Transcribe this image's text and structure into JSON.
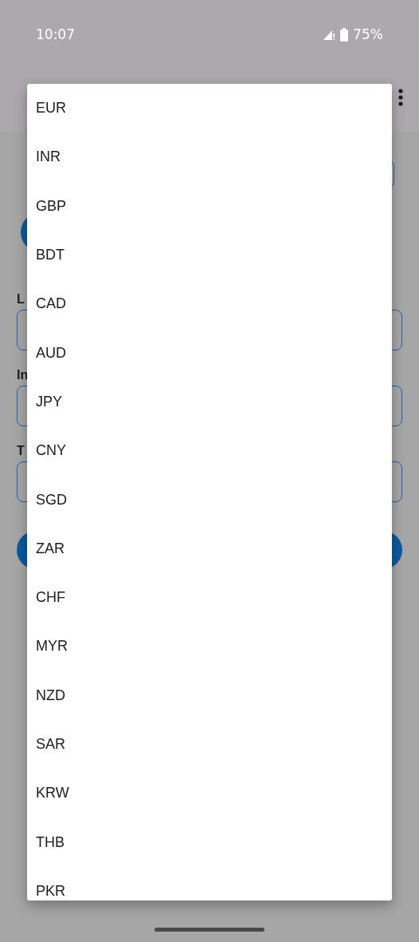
{
  "status_bar": {
    "time": "10:07",
    "battery": "75%"
  },
  "form": {
    "fields": [
      {
        "label": "L"
      },
      {
        "label": "In"
      },
      {
        "label": "T"
      }
    ]
  },
  "currency_menu": {
    "items": [
      {
        "label": "EUR"
      },
      {
        "label": "INR"
      },
      {
        "label": "GBP"
      },
      {
        "label": "BDT"
      },
      {
        "label": "CAD"
      },
      {
        "label": "AUD"
      },
      {
        "label": "JPY"
      },
      {
        "label": "CNY"
      },
      {
        "label": "SGD"
      },
      {
        "label": "ZAR"
      },
      {
        "label": "CHF"
      },
      {
        "label": "MYR"
      },
      {
        "label": "NZD"
      },
      {
        "label": "SAR"
      },
      {
        "label": "KRW"
      },
      {
        "label": "THB"
      },
      {
        "label": "PKR"
      }
    ]
  }
}
